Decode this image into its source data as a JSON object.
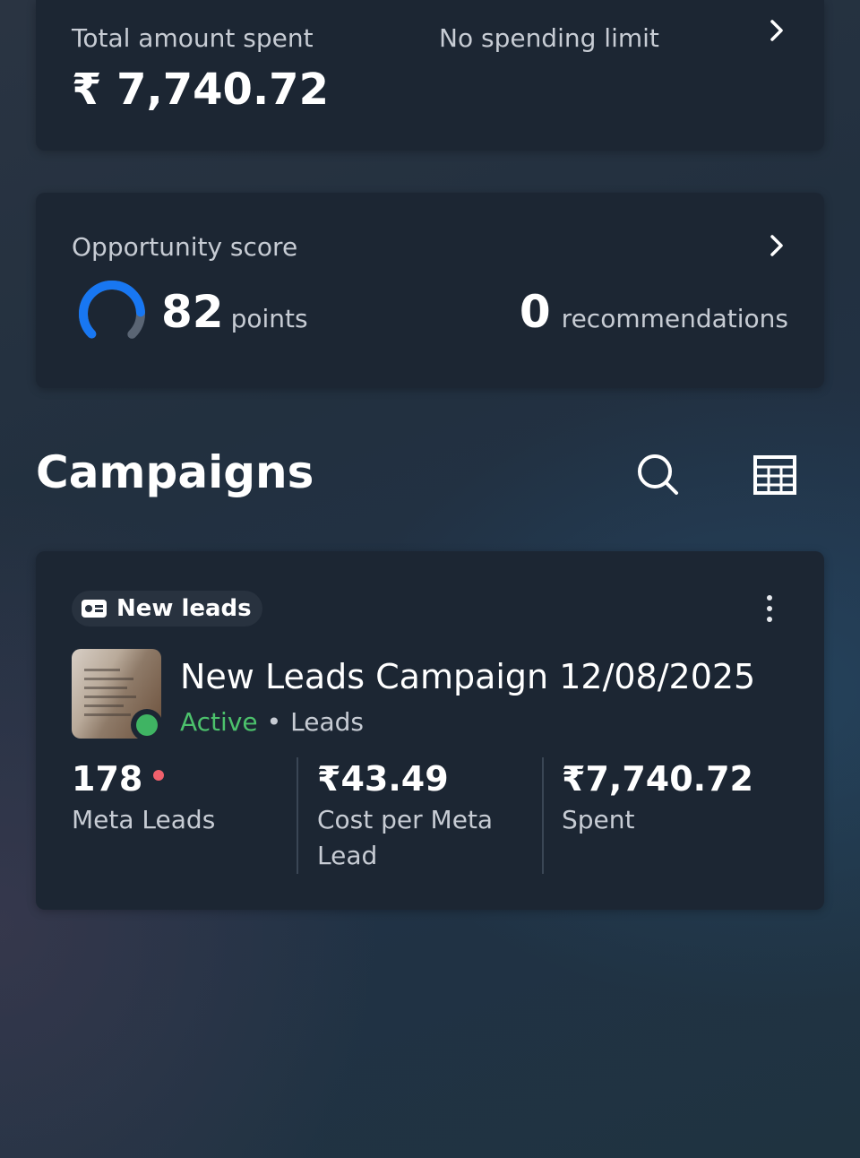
{
  "spend": {
    "label": "Total amount spent",
    "amount": "₹ 7,740.72",
    "limit_label": "No spending limit"
  },
  "opportunity": {
    "label": "Opportunity score",
    "score": "82",
    "score_unit": "points",
    "score_value": 82,
    "score_max": 100,
    "recommendations": "0",
    "recommendations_unit": "recommendations"
  },
  "campaigns": {
    "title": "Campaigns"
  },
  "campaign": {
    "objective_badge": "New leads",
    "name": "New Leads Campaign 12/08/2025",
    "status": "Active",
    "separator": "•",
    "result_type": "Leads",
    "metrics": [
      {
        "value": "178",
        "label": "Meta Leads"
      },
      {
        "value": "₹43.49",
        "label": "Cost per Meta Lead"
      },
      {
        "value": "₹7,740.72",
        "label": "Spent"
      }
    ]
  },
  "colors": {
    "accent": "#1877f2",
    "active": "#4cc26c",
    "alert_dot": "#f0606c",
    "card": "#1c2633"
  },
  "icons": [
    "chevron-right-icon",
    "gauge-icon",
    "search-icon",
    "table-icon",
    "lead-form-icon",
    "more-vertical-icon"
  ]
}
